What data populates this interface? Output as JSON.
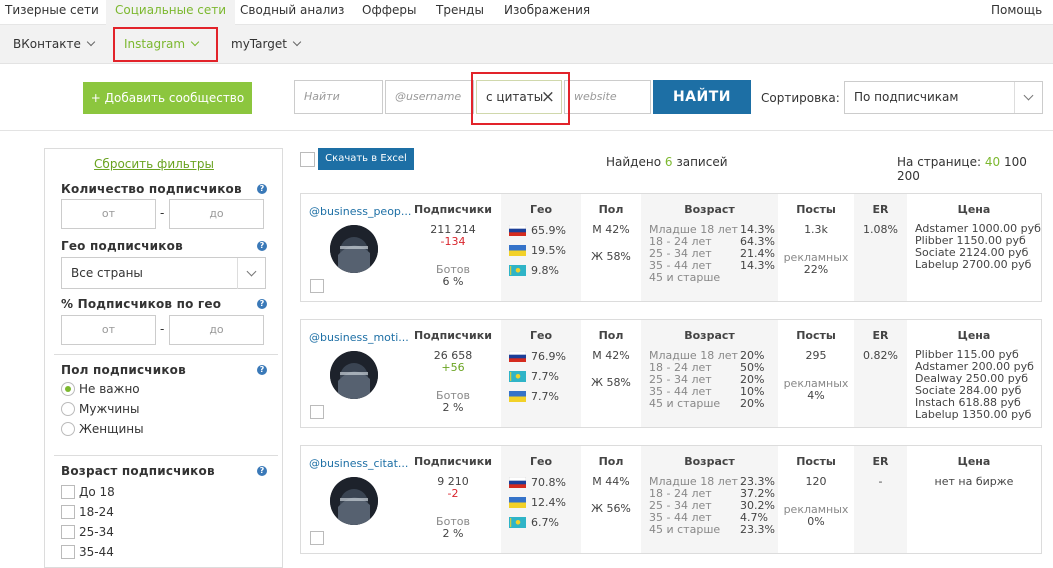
{
  "topnav": {
    "items": [
      "Тизерные сети",
      "Социальные сети",
      "Сводный анализ",
      "Офферы",
      "Тренды",
      "Изображения"
    ],
    "help": "Помощь"
  },
  "subnav": {
    "items": [
      "ВКонтакте",
      "Instagram",
      "myTarget"
    ]
  },
  "search": {
    "add_label": "+ Добавить сообщество",
    "name_placeholder": "Найти",
    "username_placeholder": "@username",
    "phrase_value": "с цитаты",
    "clear_icon": "×",
    "website_placeholder": "website",
    "find_label": "НАЙТИ",
    "sort_label": "Сортировка:",
    "sort_value": "По подписчикам"
  },
  "filters": {
    "reset": "Сбросить фильтры",
    "subs_label": "Количество подписчиков",
    "from": "от",
    "to": "до",
    "dash": "-",
    "help": "?",
    "geo_label": "Гео подписчиков",
    "geo_value": "Все страны",
    "geo_pct_label": "% Подписчиков по гео",
    "gender_label": "Пол подписчиков",
    "gender_options": [
      "Не важно",
      "Мужчины",
      "Женщины"
    ],
    "age_label": "Возраст подписчиков",
    "age_options": [
      "До 18",
      "18-24",
      "25-34",
      "35-44"
    ]
  },
  "results": {
    "excel_label": "Скачать в Excel",
    "found_prefix": "Найдено",
    "found_count": "6",
    "found_suffix": "записей",
    "per_page_label": "На странице:",
    "per_page": [
      "40",
      "100",
      "200"
    ]
  },
  "headers": {
    "subs": "Подписчики",
    "geo": "Гео",
    "gender": "Пол",
    "age": "Возраст",
    "posts": "Посты",
    "er": "ER",
    "price": "Цена",
    "bots": "Ботов",
    "ads": "рекламных"
  },
  "age_labels": [
    "Младше 18 лет",
    "18 - 24 лет",
    "25 - 34 лет",
    "35 - 44 лет",
    "45 и старше"
  ],
  "colors": {
    "accent_green": "#7cb82f",
    "button_blue": "#1d6fa5",
    "highlight_red": "#e2232a"
  },
  "cards": [
    {
      "username": "@business_peop...",
      "subs": "211 214",
      "delta": "-134",
      "bots": "6 %",
      "geo": [
        {
          "flag": "russia-flag-icon",
          "pct": "65.9%"
        },
        {
          "flag": "ukraine-flag-icon",
          "pct": "19.5%"
        },
        {
          "flag": "kazakhstan-flag-icon",
          "pct": "9.8%"
        }
      ],
      "male": "М 42%",
      "female": "Ж 58%",
      "age": [
        "14.3%",
        "64.3%",
        "21.4%",
        "14.3%"
      ],
      "posts": "1.3k",
      "ads": "22%",
      "er": "1.08%",
      "prices": [
        "Adstamer 1000.00 руб",
        "Plibber 1150.00 руб",
        "Sociate 2124.00 руб",
        "Labelup 2700.00 руб"
      ]
    },
    {
      "username": "@business_moti...",
      "subs": "26 658",
      "delta": "+56",
      "bots": "2 %",
      "geo": [
        {
          "flag": "russia-flag-icon",
          "pct": "76.9%"
        },
        {
          "flag": "kazakhstan-flag-icon",
          "pct": "7.7%"
        },
        {
          "flag": "ukraine-flag-icon",
          "pct": "7.7%"
        }
      ],
      "male": "М 42%",
      "female": "Ж 58%",
      "age": [
        "20%",
        "50%",
        "20%",
        "10%",
        "20%"
      ],
      "posts": "295",
      "ads": "4%",
      "er": "0.82%",
      "prices": [
        "Plibber 115.00 руб",
        "Adstamer 200.00 руб",
        "Dealway 250.00 руб",
        "Sociate 284.00 руб",
        "Instach 618.88 руб",
        "Labelup 1350.00 руб"
      ]
    },
    {
      "username": "@business_citat...",
      "subs": "9 210",
      "delta": "-2",
      "bots": "2 %",
      "geo": [
        {
          "flag": "russia-flag-icon",
          "pct": "70.8%"
        },
        {
          "flag": "ukraine-flag-icon",
          "pct": "12.4%"
        },
        {
          "flag": "kazakhstan-flag-icon",
          "pct": "6.7%"
        }
      ],
      "male": "М 44%",
      "female": "Ж 56%",
      "age": [
        "23.3%",
        "37.2%",
        "30.2%",
        "4.7%",
        "23.3%"
      ],
      "posts": "120",
      "ads": "0%",
      "er": "-",
      "prices": [
        "нет на бирже"
      ]
    }
  ]
}
